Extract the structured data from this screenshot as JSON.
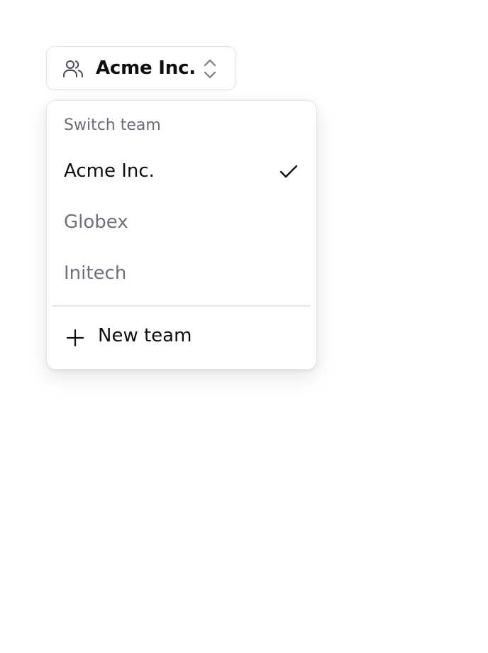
{
  "switcher": {
    "label": "Acme Inc.",
    "icon": "users-icon",
    "chevron_icon": "chevrons-up-down-icon"
  },
  "menu": {
    "heading": "Switch team",
    "items": [
      {
        "label": "Acme Inc.",
        "selected": true
      },
      {
        "label": "Globex",
        "selected": false
      },
      {
        "label": "Initech",
        "selected": false
      }
    ],
    "new_team_label": "New team",
    "selected_icon": "check-icon",
    "new_team_icon": "plus-icon"
  },
  "colors": {
    "text_primary": "#0f0f12",
    "text_muted": "#71717a",
    "border": "#e4e4e7",
    "background": "#ffffff"
  }
}
